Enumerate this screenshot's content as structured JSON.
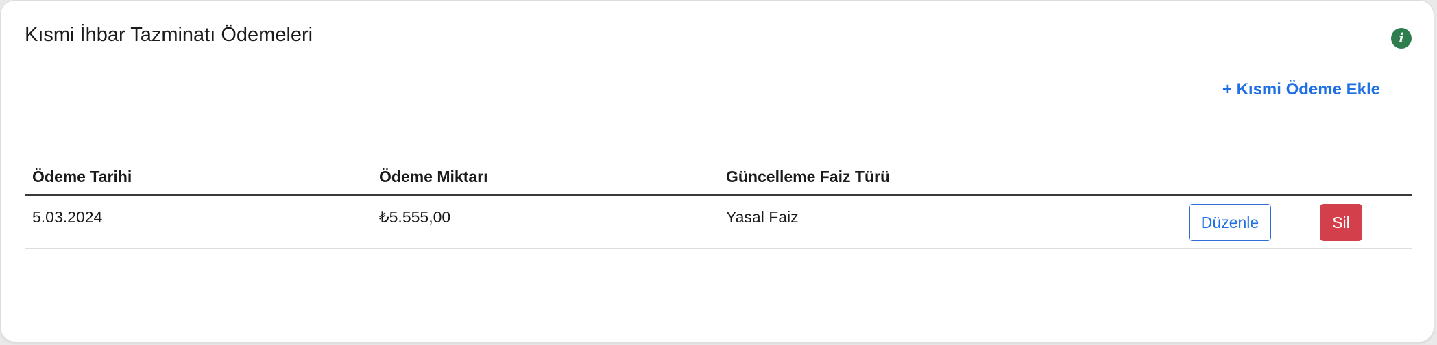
{
  "card": {
    "title": "Kısmi İhbar Tazminatı Ödemeleri",
    "info_icon": "i",
    "add_link_label": "+ Kısmi Ödeme Ekle"
  },
  "table": {
    "columns": [
      "Ödeme Tarihi",
      "Ödeme Miktarı",
      "Güncelleme Faiz Türü"
    ],
    "rows": [
      {
        "date": "5.03.2024",
        "amount": "₺5.555,00",
        "interest_type": "Yasal Faiz",
        "edit_label": "Düzenle",
        "delete_label": "Sil"
      }
    ]
  },
  "colors": {
    "accent_blue": "#1f6fe5",
    "danger_red": "#d3404b",
    "info_green": "#2e7d4f"
  },
  "icons": {
    "info": "info-icon"
  }
}
